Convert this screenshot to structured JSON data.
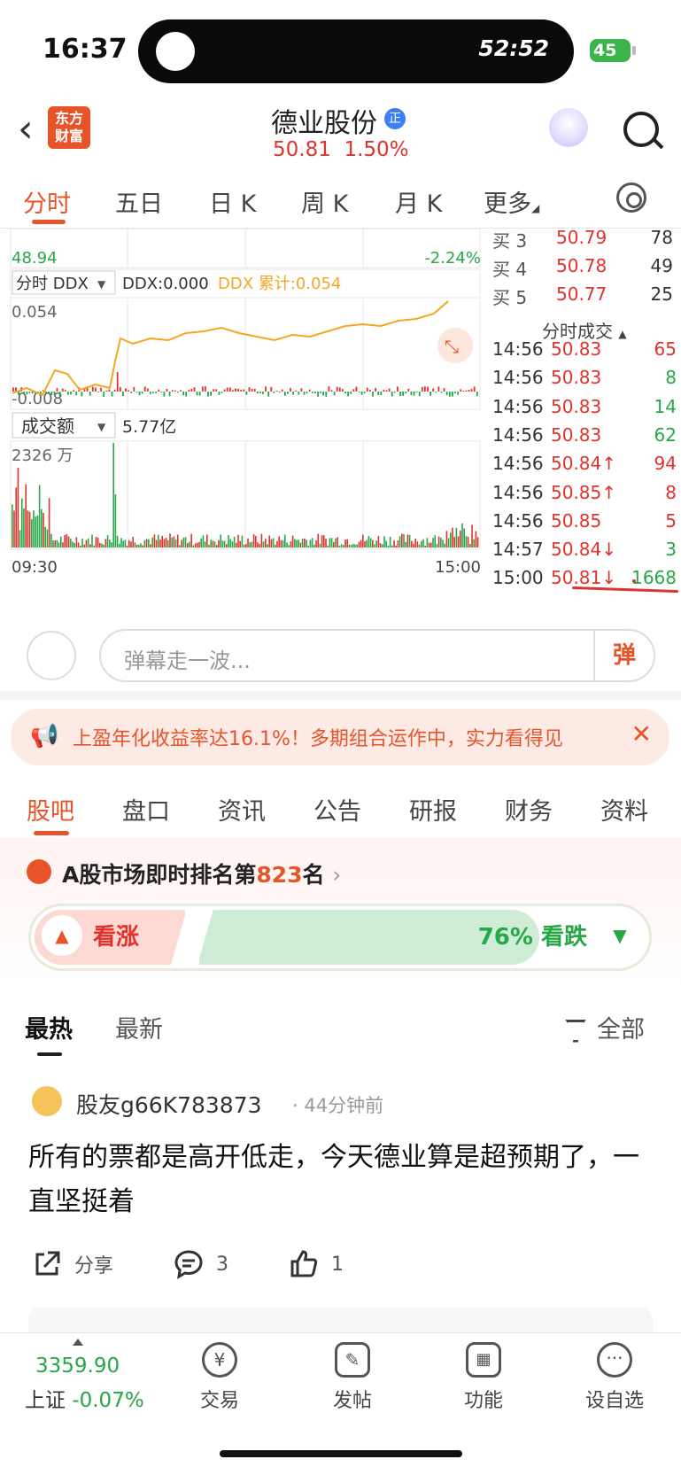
{
  "status": {
    "time": "16:37",
    "island_timer": "52:52",
    "battery": "45"
  },
  "header": {
    "back": "‹",
    "logo_line1": "东方",
    "logo_line2": "财富",
    "stock_name": "德业股份",
    "badge": "正",
    "price": "50.81",
    "change_pct": "1.50%"
  },
  "period_tabs": {
    "intraday": "分时",
    "five_day": "五日",
    "daily": "日 K",
    "weekly": "周 K",
    "monthly": "月 K",
    "more": "更多"
  },
  "price_panel": {
    "low_price": "48.94",
    "low_pct": "-2.24%"
  },
  "ddx_panel": {
    "selector": "分时 DDX",
    "ddx_value": "DDX:0.000",
    "ddx_cum": "DDX 累计:0.054",
    "top_label": "0.054",
    "bottom_label": "-0.008"
  },
  "volume_panel": {
    "selector": "成交额",
    "total": "5.77亿",
    "max_label": "2326 万"
  },
  "time_axis": {
    "start": "09:30",
    "end": "15:00"
  },
  "order_book": [
    {
      "label": "买 3",
      "price": "50.79",
      "vol": "78"
    },
    {
      "label": "买 4",
      "price": "50.78",
      "vol": "49"
    },
    {
      "label": "买 5",
      "price": "50.77",
      "vol": "25"
    }
  ],
  "ticks_header": "分时成交",
  "ticks": [
    {
      "time": "14:56",
      "price": "50.83",
      "vol": "65",
      "dir": "up"
    },
    {
      "time": "14:56",
      "price": "50.83",
      "vol": "8",
      "dir": "dn"
    },
    {
      "time": "14:56",
      "price": "50.83",
      "vol": "14",
      "dir": "dn"
    },
    {
      "time": "14:56",
      "price": "50.83",
      "vol": "62",
      "dir": "dn"
    },
    {
      "time": "14:56",
      "price": "50.84↑",
      "vol": "94",
      "dir": "up"
    },
    {
      "time": "14:56",
      "price": "50.85↑",
      "vol": "8",
      "dir": "up"
    },
    {
      "time": "14:56",
      "price": "50.85",
      "vol": "5",
      "dir": "up"
    },
    {
      "time": "14:57",
      "price": "50.84↓",
      "vol": "3",
      "dir": "dn"
    },
    {
      "time": "15:00",
      "price": "50.81↓",
      "vol": "1668",
      "dir": "dn"
    }
  ],
  "danmu": {
    "placeholder": "弹幕走一波...",
    "send": "弹"
  },
  "ad": {
    "text": "上盈年化收益率达16.1%！多期组合运作中，实力看得见",
    "close": "✕"
  },
  "section_tabs": [
    "股吧",
    "盘口",
    "资讯",
    "公告",
    "研报",
    "财务",
    "资料"
  ],
  "rank": {
    "prefix": "A股市场即时排名第",
    "num": "823",
    "suffix": "名",
    "arrow": "›"
  },
  "vote": {
    "up_label": "看涨",
    "down_pct": "76%",
    "down_label": "看跌",
    "down_fraction": 0.76
  },
  "feed_tabs": {
    "hot": "最热",
    "new": "最新",
    "filter": "全部"
  },
  "post": {
    "author": "股友g66K783873",
    "ago": "· 44分钟前",
    "content": "所有的票都是高开低走，今天德业算是超预期了，一直坚挺着",
    "share": "分享",
    "comments": "3",
    "likes": "1"
  },
  "tabbar": {
    "index_value": "3359.90",
    "index_name": "上证",
    "index_change": "-0.07%",
    "trade": "交易",
    "post": "发帖",
    "features": "功能",
    "watchlist": "设自选"
  },
  "colors": {
    "accent": "#e8542a",
    "up": "#e0332c",
    "down": "#26a847",
    "ddx_line": "#f5a623"
  }
}
